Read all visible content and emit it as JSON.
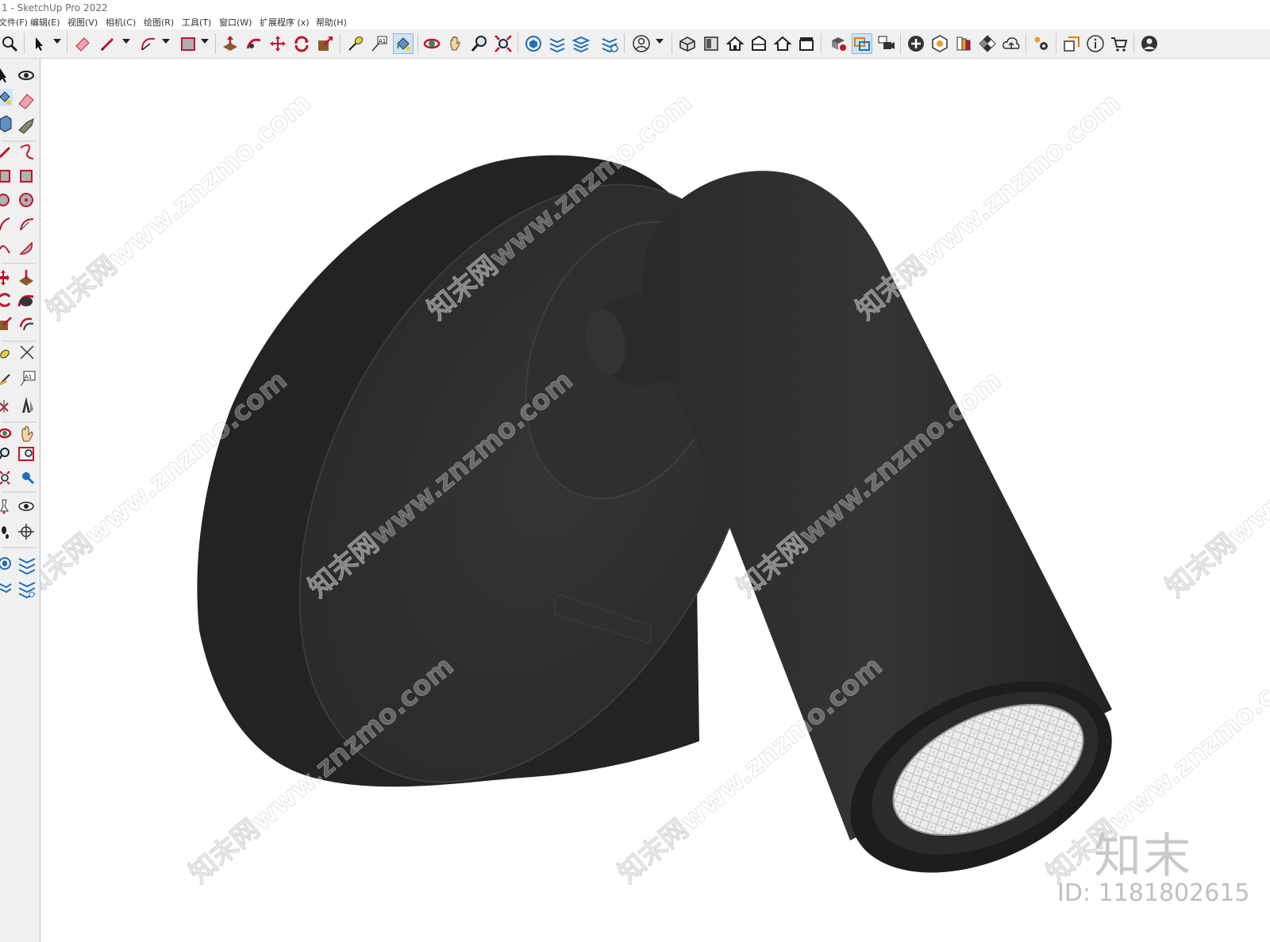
{
  "window": {
    "title": "1 - SketchUp Pro 2022"
  },
  "menu": [
    {
      "label": "文件(F)"
    },
    {
      "label": "编辑(E)"
    },
    {
      "label": "视图(V)"
    },
    {
      "label": "相机(C)"
    },
    {
      "label": "绘图(R)"
    },
    {
      "label": "工具(T)"
    },
    {
      "label": "窗口(W)"
    },
    {
      "label": "扩展程序 (x)"
    },
    {
      "label": "帮助(H)"
    }
  ],
  "toolbar_icons": [
    "zoom-icon",
    "select-icon",
    "eraser-icon",
    "pencil-icon",
    "arc-icon",
    "rectangle-icon",
    "push-pull-icon",
    "follow-me-icon",
    "move-icon",
    "rotate-icon",
    "scale-icon",
    "tape-measure-icon",
    "text-icon",
    "paint-bucket-icon",
    "orbit-icon",
    "pan-icon",
    "zoom-tool-icon",
    "zoom-extents-icon",
    "3d-warehouse-icon",
    "extension-warehouse-icon",
    "layout-icon",
    "extension-manager-icon",
    "user-account-icon",
    "iso-view-icon",
    "top-view-icon",
    "front-view-icon",
    "right-view-icon",
    "back-view-icon",
    "left-view-icon",
    "solid-tools-icon",
    "section-plane-icon",
    "scenes-icon",
    "add-location-icon",
    "sandbox-icon",
    "styles-icon",
    "materials-icon",
    "cloud-upload-icon",
    "settings-icon",
    "components-icon",
    "model-info-icon",
    "cart-icon",
    "profile-icon"
  ],
  "lefttool_icons": [
    "select-icon",
    "orbit-icon",
    "paint-bucket-icon",
    "eraser-icon",
    "component-icon",
    "tag-icon",
    "line-icon",
    "freehand-icon",
    "rectangle-icon",
    "rotated-rectangle-icon",
    "circle-icon",
    "polygon-icon",
    "arc-icon",
    "pie-icon",
    "two-point-arc-icon",
    "three-point-arc-icon",
    "move-icon",
    "push-pull-icon",
    "rotate-icon",
    "follow-me-icon",
    "scale-icon",
    "offset-icon",
    "tape-measure-icon",
    "dimension-icon",
    "protractor-icon",
    "text-icon",
    "axes-icon",
    "3d-text-icon",
    "orbit-tool-icon",
    "pan-icon",
    "zoom-icon",
    "zoom-window-icon",
    "zoom-extents-icon",
    "previous-view-icon",
    "position-camera-icon",
    "look-around-icon",
    "walk-icon",
    "section-plane-icon",
    "warehouse-icon",
    "extension-warehouse-icon",
    "layout-icon",
    "extension-manager-icon"
  ],
  "watermark": {
    "text": "知末网www.znzmo.com"
  },
  "brand": {
    "logo_text": "知末"
  },
  "model_id": {
    "label": "ID: 1181802615"
  },
  "colors": {
    "lamp_body": "#2e2e2e",
    "lamp_dark": "#1f1f1f",
    "reflector": "#e9e9e9",
    "watermark": "#c8c8c8"
  }
}
